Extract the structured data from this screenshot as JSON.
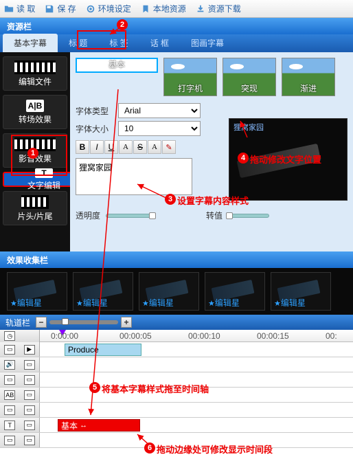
{
  "topbar": {
    "read": "读 取",
    "save": "保 存",
    "env": "环境设定",
    "local": "本地资源",
    "download": "资源下载"
  },
  "panels": {
    "resource": "资源栏",
    "fxbin": "效果收集栏",
    "track": "轨道栏"
  },
  "tabs": {
    "items": [
      "基本字幕",
      "标 题",
      "标 签",
      "话 框",
      "图画字幕"
    ]
  },
  "side": {
    "items": [
      "编辑文件",
      "转场效果",
      "影音效果",
      "文字编辑",
      "片头/片尾"
    ]
  },
  "thumbs": {
    "items": [
      "基本",
      "打字机",
      "突现",
      "渐进"
    ]
  },
  "form": {
    "font_type_label": "字体类型",
    "font_type_value": "Arial",
    "font_size_label": "字体大小",
    "font_size_value": "10",
    "text_value": "狸窝家园",
    "opacity_label": "透明度",
    "rotate_label": "转值"
  },
  "preview": {
    "sample": "狸窝家园"
  },
  "fxbin": {
    "star": "编辑星"
  },
  "timeline": {
    "marks": [
      "0:00:00",
      "00:00:05",
      "00:00:10",
      "00:00:15",
      "00:"
    ],
    "produce_clip": "Produce",
    "sub_clip": "基本"
  },
  "annos": {
    "a1": "",
    "a2": "",
    "a3": "设置字幕内容样式",
    "a4": "拖动修改文字位置",
    "a5": "将基本字幕样式拖至时间轴",
    "a6": "拖动边缘处可修改显示时间段"
  }
}
